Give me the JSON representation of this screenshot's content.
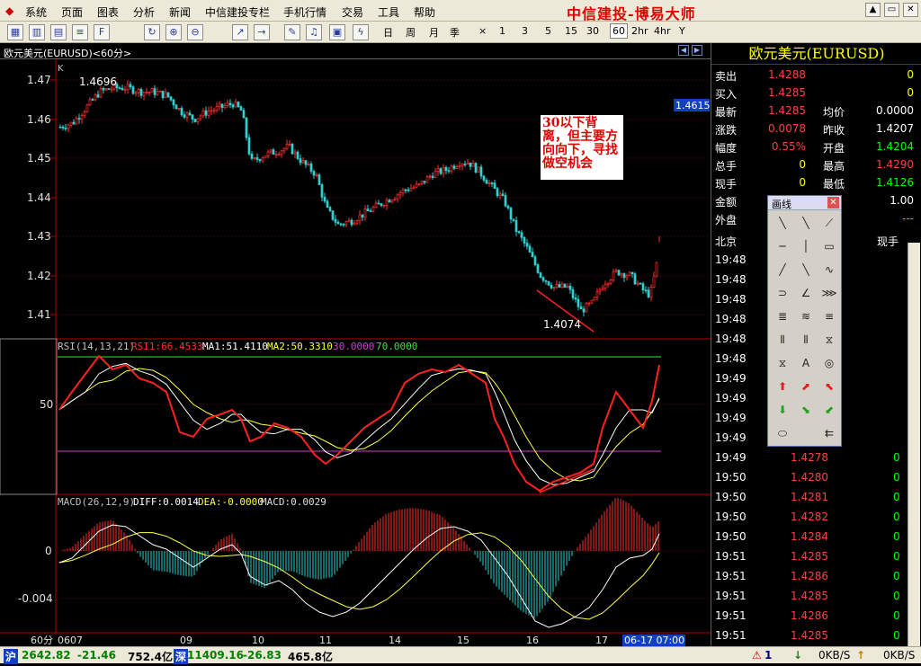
{
  "menu": [
    "系统",
    "页面",
    "图表",
    "分析",
    "新闻",
    "中信建投专栏",
    "手机行情",
    "交易",
    "工具",
    "帮助"
  ],
  "brand": "中信建投-博易大师",
  "window_buttons": [
    "▲",
    "▭",
    "✕"
  ],
  "toolbar": {
    "icons": [
      "grid-icon",
      "bar-icon",
      "candle-icon",
      "list-icon",
      "f10-icon",
      "refresh-icon",
      "zoom-in-icon",
      "zoom-out-icon",
      "export-icon",
      "import-icon",
      "draw-icon",
      "alarm-icon",
      "gallery-icon",
      "lightning-icon"
    ],
    "periods": [
      "日",
      "周",
      "月",
      "季",
      "×",
      "1",
      "3",
      "5",
      "15",
      "30",
      "60",
      "2hr",
      "4hr",
      "Y"
    ],
    "active_period": "60"
  },
  "chart": {
    "title": "欧元美元(EURUSD)<60分>",
    "k_label": "K",
    "price_ticks": [
      "1.47",
      "1.46",
      "1.45",
      "1.44",
      "1.43",
      "1.42",
      "1.41"
    ],
    "high_label": "1.4696",
    "low_label": "1.4074",
    "current_price": "1.4615",
    "rsi": {
      "label": "RSI(14,13,21)",
      "rsi1": "RSI1:66.4533",
      "ma1": "MA1:51.4110",
      "ma2": "MA2:50.3310",
      "v30": "30.0000",
      "v70": "70.0000",
      "tick": "50"
    },
    "macd": {
      "label": "MACD(26,12,9)",
      "diff": "DIFF:0.0014",
      "dea": "DEA:-0.0000",
      "macd": "MACD:0.0029",
      "ticks": [
        "0",
        "-0.004"
      ]
    },
    "x_labels": [
      "0607",
      "09",
      "10",
      "11",
      "14",
      "15",
      "16",
      "17"
    ],
    "period_label": "60分",
    "cursor_time": "06-17 07:00",
    "annotation": "30以下背离，但主要方向向下，寻找做空机会"
  },
  "quote": {
    "title": "欧元美元(EURUSD)",
    "left": [
      [
        "卖出",
        "1.4288",
        "#ff4040"
      ],
      [
        "买入",
        "1.4285",
        "#ff4040"
      ],
      [
        "最新",
        "1.4285",
        "#ff4040"
      ],
      [
        "涨跌",
        "0.0078",
        "#ff4040"
      ],
      [
        "幅度",
        "0.55%",
        "#ff4040"
      ],
      [
        "总手",
        "0",
        "#ffff00"
      ],
      [
        "现手",
        "0",
        "#ffff00"
      ],
      [
        "金额",
        "",
        ""
      ],
      [
        "外盘",
        "",
        ""
      ]
    ],
    "right": [
      [
        "",
        "0",
        "#ffff00"
      ],
      [
        "",
        "0",
        "#ffff00"
      ],
      [
        "均价",
        "0.0000",
        "#ffffff"
      ],
      [
        "昨收",
        "1.4207",
        "#ffffff"
      ],
      [
        "开盘",
        "1.4204",
        "#00ff00"
      ],
      [
        "最高",
        "1.4290",
        "#ff4040"
      ],
      [
        "最低",
        "1.4126",
        "#00ff00"
      ],
      [
        "比",
        "1.00",
        "#ffffff"
      ],
      [
        "盘",
        "---",
        "#00ff00"
      ]
    ],
    "ticks_header": [
      "北京",
      "现手"
    ],
    "ticks": [
      [
        "19:48",
        "",
        ""
      ],
      [
        "19:48",
        "",
        ""
      ],
      [
        "19:48",
        "",
        ""
      ],
      [
        "19:48",
        "",
        ""
      ],
      [
        "19:48",
        "",
        ""
      ],
      [
        "19:48",
        "",
        ""
      ],
      [
        "19:49",
        "",
        ""
      ],
      [
        "19:49",
        "",
        ""
      ],
      [
        "19:49",
        "",
        ""
      ],
      [
        "19:49",
        "",
        ""
      ],
      [
        "19:49",
        "1.4278",
        "0"
      ],
      [
        "19:50",
        "1.4280",
        "0"
      ],
      [
        "19:50",
        "1.4281",
        "0"
      ],
      [
        "19:50",
        "1.4282",
        "0"
      ],
      [
        "19:50",
        "1.4284",
        "0"
      ],
      [
        "19:51",
        "1.4285",
        "0"
      ],
      [
        "19:51",
        "1.4286",
        "0"
      ],
      [
        "19:51",
        "1.4285",
        "0"
      ],
      [
        "19:51",
        "1.4286",
        "0"
      ],
      [
        "19:51",
        "1.4285",
        "0"
      ],
      [
        "19:51",
        "1.4285",
        "0"
      ]
    ]
  },
  "draw_tool": {
    "title": "画线"
  },
  "status": {
    "sh_label": "沪",
    "sh_index": "2642.82",
    "sh_change": "-21.46",
    "sh_amount": "752.4亿",
    "sz_label": "深",
    "sz_index": "11409.16",
    "sz_change": "-26.83",
    "sz_amount": "465.8亿",
    "alert": "1",
    "net1": "0KB/S",
    "net2": "0KB/S"
  }
}
